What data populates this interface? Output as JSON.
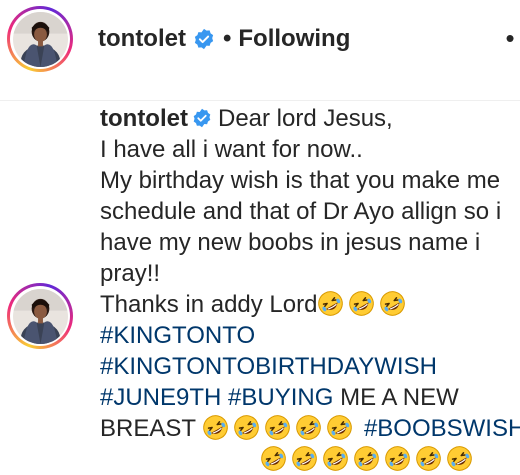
{
  "header": {
    "username": "tontolet",
    "verified_icon": "verified-badge-icon",
    "separator": "•",
    "follow_status": "Following",
    "more_icon": "•"
  },
  "caption": {
    "username": "tontolet",
    "line1_text": "Dear lord Jesus,",
    "line2": "I have all i want for now..",
    "line3": "My birthday wish is that you make me",
    "line4": "schedule and that of Dr Ayo allign so i",
    "line5": "have my new boobs in jesus name i",
    "line6": "pray!!",
    "line7_text": "Thanks in addy Lord",
    "hashtag1": "#KINGTONTO",
    "hashtag2": "#KINGTONTOBIRTHDAYWISH",
    "hashtag3": "#JUNE9TH",
    "hashtag4": "#BUYING",
    "line10_text": "ME A NEW",
    "line11_text": "BREAST",
    "hashtag5": "#BOOBSWISH",
    "emoji_icon": "rofl-emoji-icon"
  },
  "colors": {
    "verified": "#3897f0",
    "hashtag": "#00376b",
    "text": "#262626",
    "emoji": "#ffcc33"
  }
}
